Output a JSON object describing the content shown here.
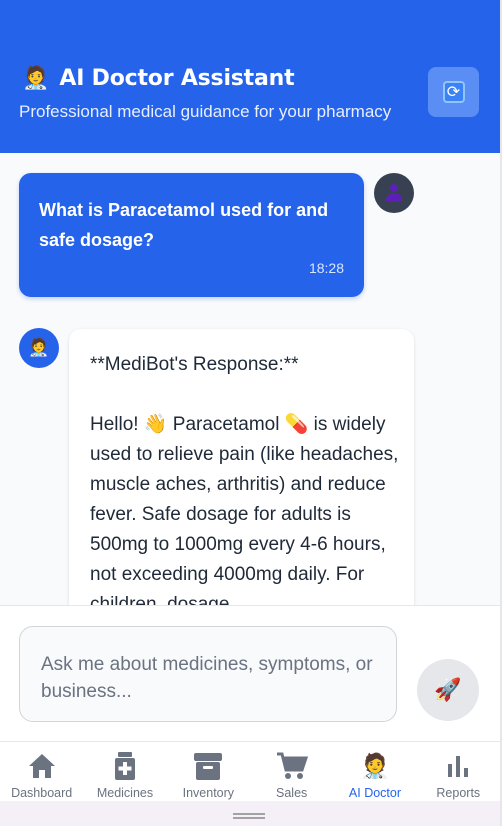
{
  "header": {
    "title_icon": "doctor-icon",
    "title": "AI Doctor Assistant",
    "subtitle": "Professional medical guidance for your pharmacy",
    "refresh_icon": "refresh-icon"
  },
  "chat": {
    "user_message": {
      "text": "What is Paracetamol used for and safe dosage?",
      "time": "18:28",
      "avatar_icon": "user-avatar-icon"
    },
    "bot_message": {
      "avatar_icon": "doctor-icon",
      "text": "**MediBot's Response:**\n\nHello! 👋 Paracetamol 💊 is widely used to relieve pain (like headaches, muscle aches, arthritis) and reduce fever. Safe dosage for adults is 500mg to 1000mg every 4-6 hours, not exceeding 4000mg daily. For children, dosage"
    }
  },
  "input": {
    "placeholder": "Ask me about medicines, symptoms, or business...",
    "send_icon": "rocket-icon"
  },
  "nav": {
    "items": [
      {
        "label": "Dashboard",
        "icon": "home-icon"
      },
      {
        "label": "Medicines",
        "icon": "medicine-icon"
      },
      {
        "label": "Inventory",
        "icon": "archive-icon"
      },
      {
        "label": "Sales",
        "icon": "cart-icon"
      },
      {
        "label": "AI Doctor",
        "icon": "doctor-icon",
        "active": true
      },
      {
        "label": "Reports",
        "icon": "bar-chart-icon"
      }
    ]
  },
  "colors": {
    "primary": "#2563eb",
    "nav_inactive": "#6b7280",
    "background": "#f8fafc"
  }
}
